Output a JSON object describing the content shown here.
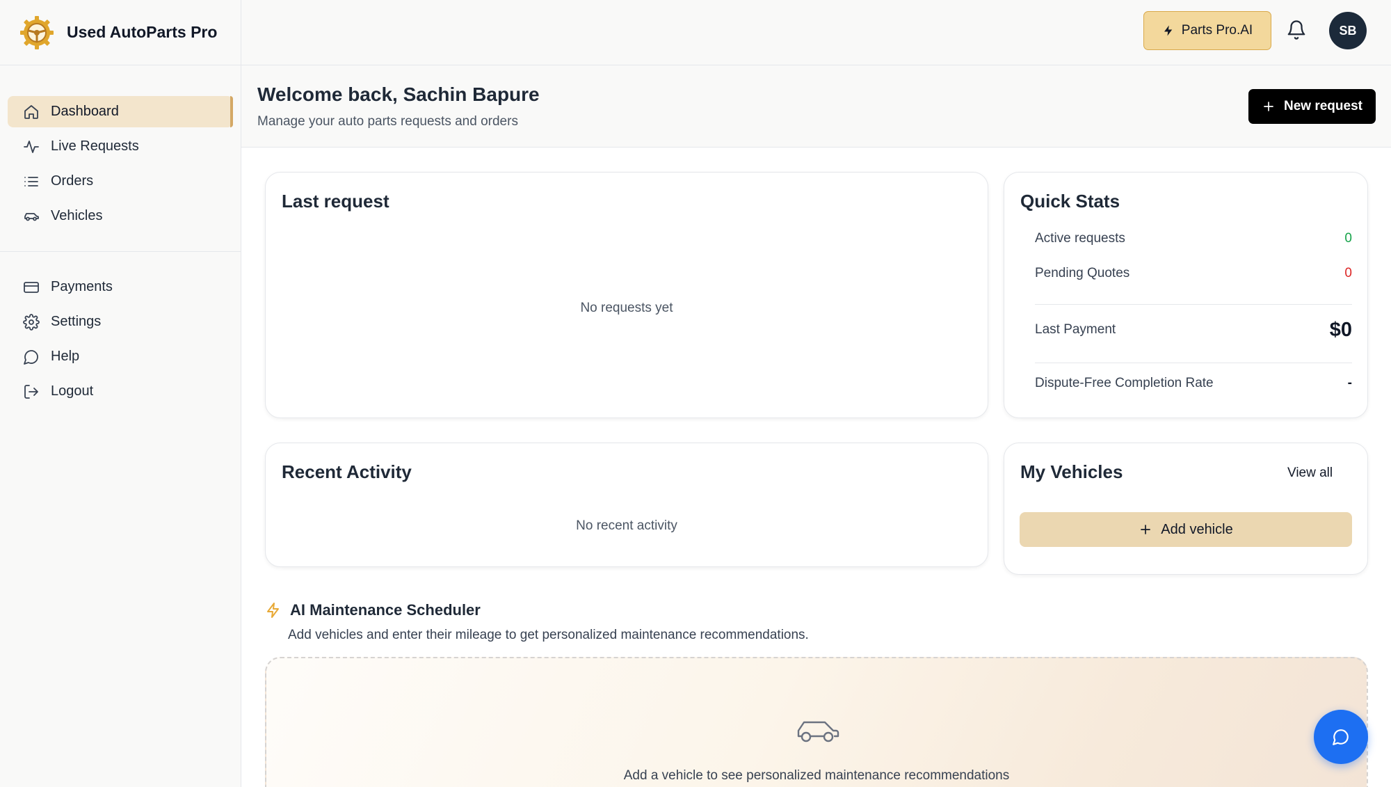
{
  "brand": {
    "name": "Used AutoParts Pro",
    "logo_icon": "steering-wheel-gear-icon"
  },
  "sidebar": {
    "primary": [
      {
        "label": "Dashboard",
        "icon": "home-icon",
        "active": true
      },
      {
        "label": "Live Requests",
        "icon": "activity-icon"
      },
      {
        "label": "Orders",
        "icon": "list-icon"
      },
      {
        "label": "Vehicles",
        "icon": "car-icon"
      }
    ],
    "secondary": [
      {
        "label": "Payments",
        "icon": "credit-card-icon"
      },
      {
        "label": "Settings",
        "icon": "gear-icon"
      },
      {
        "label": "Help",
        "icon": "chat-bubble-icon"
      },
      {
        "label": "Logout",
        "icon": "logout-icon"
      }
    ]
  },
  "topbar": {
    "pro_button": "Parts Pro.AI",
    "avatar_initials": "SB"
  },
  "header": {
    "welcome": "Welcome back, Sachin Bapure",
    "subtitle": "Manage your auto parts requests and orders",
    "new_request": "New request"
  },
  "last_request": {
    "title": "Last request",
    "empty": "No requests yet"
  },
  "quick_stats": {
    "title": "Quick Stats",
    "active_label": "Active requests",
    "active_value": "0",
    "pending_label": "Pending Quotes",
    "pending_value": "0",
    "payment_label": "Last Payment",
    "payment_value": "$0",
    "dispute_label": "Dispute-Free Completion Rate",
    "dispute_value": "-"
  },
  "recent_activity": {
    "title": "Recent Activity",
    "empty": "No recent activity"
  },
  "my_vehicles": {
    "title": "My Vehicles",
    "view_all": "View all",
    "add_vehicle": "Add vehicle"
  },
  "ai_scheduler": {
    "title": "AI Maintenance Scheduler",
    "description": "Add vehicles and enter their mileage to get personalized maintenance recommendations.",
    "empty_message": "Add a vehicle to see personalized maintenance recommendations"
  },
  "colors": {
    "accent": "#f3d89c",
    "accent_border": "#d9a94a",
    "active_nav": "#f3e5cc",
    "positive": "#16a34a",
    "negative": "#dc2626",
    "chat_fab": "#1d6ff2"
  }
}
